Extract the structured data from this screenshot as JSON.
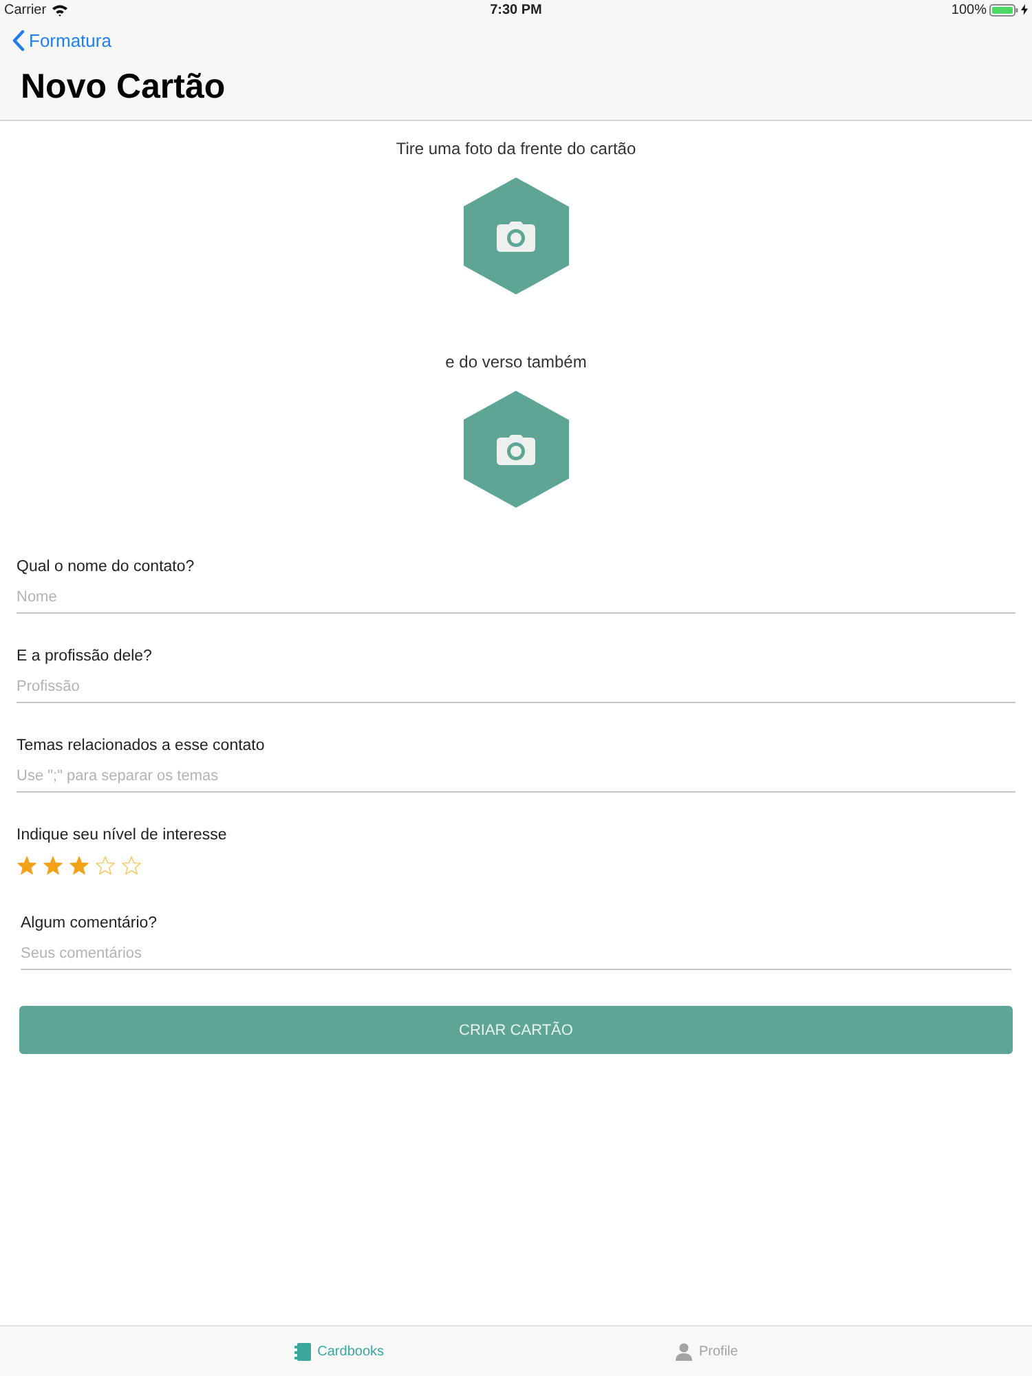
{
  "status_bar": {
    "carrier": "Carrier",
    "time": "7:30 PM",
    "battery": "100%",
    "charging": true
  },
  "nav": {
    "back": "Formatura",
    "title": "Novo Cartão"
  },
  "photo_prompts": [
    {
      "label": "Tire uma foto da frente do cartão"
    },
    {
      "label": "e do verso também"
    }
  ],
  "form": [
    {
      "kind": "text",
      "label": "Qual o nome do contato?",
      "placeholder": "Nome"
    },
    {
      "kind": "text",
      "label": "E a profissão dele?",
      "placeholder": "Profissão"
    },
    {
      "kind": "text",
      "label": "Temas relacionados a esse contato",
      "placeholder": "Use \";\" para separar os temas"
    },
    {
      "kind": "rating",
      "label": "Indique seu nível de interesse",
      "stars": 3
    },
    {
      "kind": "text",
      "label": "Algum comentário?",
      "placeholder": "Seus comentários"
    }
  ],
  "submit": {
    "label": "CRIAR CARTÃO"
  },
  "tabs": [
    {
      "label": "Cardbooks",
      "selected": true
    },
    {
      "label": "Profile",
      "selected": false
    }
  ]
}
